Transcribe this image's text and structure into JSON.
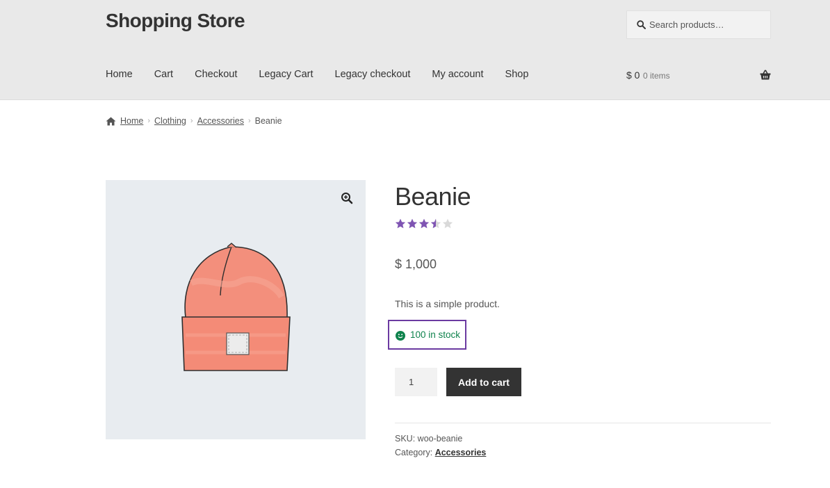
{
  "site": {
    "title": "Shopping Store"
  },
  "search": {
    "placeholder": "Search products…"
  },
  "nav": [
    "Home",
    "Cart",
    "Checkout",
    "Legacy Cart",
    "Legacy checkout",
    "My account",
    "Shop"
  ],
  "cart": {
    "total": "$ 0",
    "count": "0 items"
  },
  "breadcrumb": {
    "home": "Home",
    "clothing": "Clothing",
    "accessories": "Accessories",
    "current": "Beanie"
  },
  "product": {
    "title": "Beanie",
    "rating": 3.5,
    "rating_max": 5,
    "price": "$ 1,000",
    "description": "This is a simple product.",
    "stock": "100 in stock",
    "quantity": "1",
    "add_to_cart": "Add to cart",
    "sku_label": "SKU:",
    "sku": "woo-beanie",
    "category_label": "Category:",
    "category": "Accessories"
  },
  "colors": {
    "accent": "#7f54b3",
    "stock": "#0f834d",
    "focus": "#6b3aa1",
    "button": "#333333"
  },
  "icons": {
    "search": "search-icon",
    "cart": "basket-icon",
    "home": "home-icon",
    "zoom": "zoom-in-icon",
    "stock": "smiley-icon"
  }
}
